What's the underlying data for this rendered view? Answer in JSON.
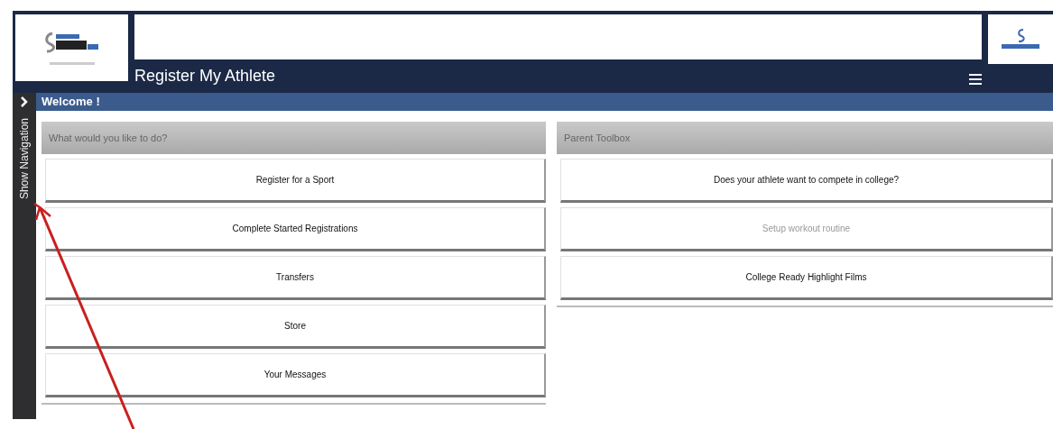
{
  "header": {
    "title": "Register My Athlete"
  },
  "welcome_bar": {
    "title": "Welcome !"
  },
  "sidebar": {
    "toggle": "Show Navigation"
  },
  "panels": [
    {
      "title": "What would you like to do?",
      "items": [
        {
          "label": "Register for a Sport",
          "disabled": false
        },
        {
          "label": "Complete Started Registrations",
          "disabled": false
        },
        {
          "label": "Transfers",
          "disabled": false
        },
        {
          "label": "Store",
          "disabled": false
        },
        {
          "label": "Your Messages",
          "disabled": false
        }
      ]
    },
    {
      "title": "Parent Toolbox",
      "items": [
        {
          "label": "Does your athlete want to compete in college?",
          "disabled": false
        },
        {
          "label": "Setup workout routine",
          "disabled": true
        },
        {
          "label": "College Ready Highlight Films",
          "disabled": false
        }
      ]
    }
  ]
}
